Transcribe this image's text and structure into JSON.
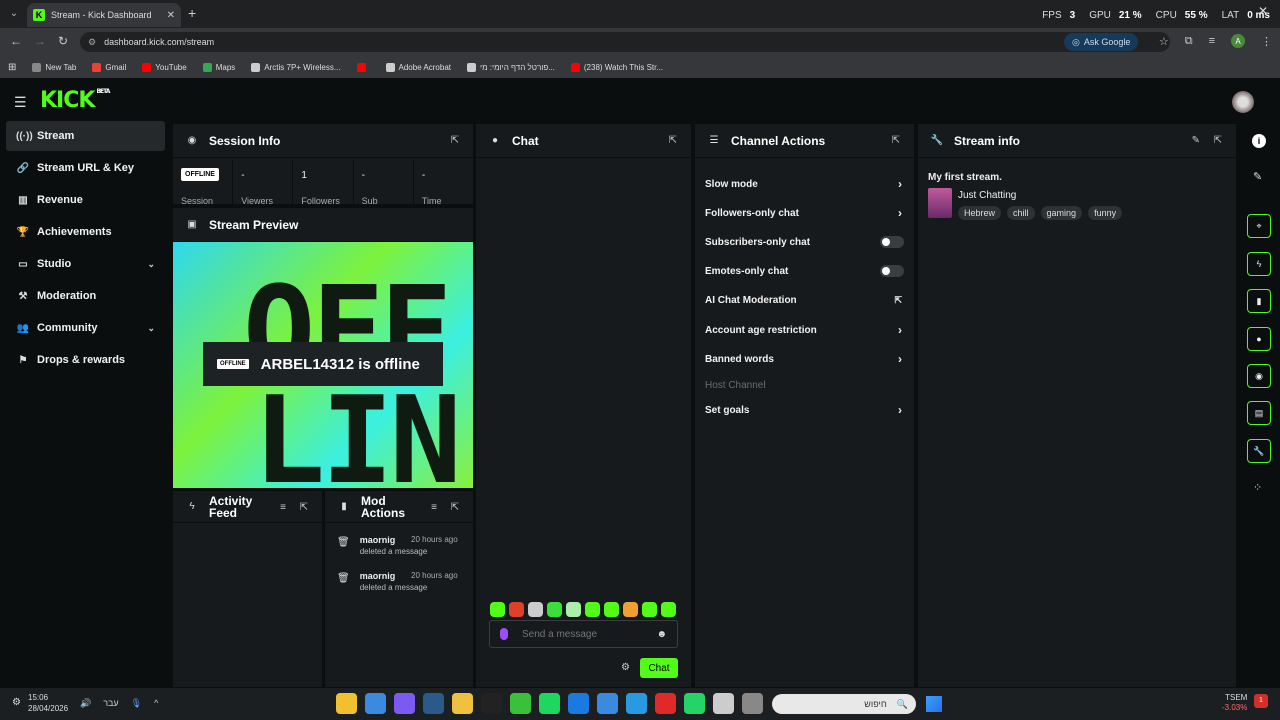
{
  "browser": {
    "tab_title": "Stream - Kick Dashboard",
    "tab_favicon": "K",
    "url": "dashboard.kick.com/stream",
    "ask_google": "Ask Google",
    "perf": [
      {
        "label": "FPS",
        "value": "3"
      },
      {
        "label": "GPU",
        "value": "21 %"
      },
      {
        "label": "CPU",
        "value": "55 %"
      },
      {
        "label": "LAT",
        "value": "0 ms"
      }
    ],
    "bookmarks": [
      {
        "label": "New Tab",
        "color": "#888888"
      },
      {
        "label": "Gmail",
        "color": "#ea4335"
      },
      {
        "label": "YouTube",
        "color": "#ff0000"
      },
      {
        "label": "Maps",
        "color": "#34a853"
      },
      {
        "label": "Arctis 7P+ Wireless...",
        "color": "#cccccc"
      },
      {
        "label": "",
        "color": "#ff0000"
      },
      {
        "label": "Adobe Acrobat",
        "color": "#cccccc"
      },
      {
        "label": "פורטל הדף היומי: מי...",
        "color": "#cccccc"
      },
      {
        "label": "(238) Watch This Str...",
        "color": "#ff0000"
      }
    ]
  },
  "kick": {
    "logo_text": "KICK",
    "logo_sup": "BETA",
    "accent": "#53fc18"
  },
  "sidebar": {
    "items": [
      {
        "label": "Stream",
        "icon": "broadcast-icon",
        "glyph": "((·))",
        "active": true
      },
      {
        "label": "Stream URL & Key",
        "icon": "link-icon",
        "glyph": "🔗"
      },
      {
        "label": "Revenue",
        "icon": "chart-icon",
        "glyph": "▥"
      },
      {
        "label": "Achievements",
        "icon": "trophy-icon",
        "glyph": "🏆"
      },
      {
        "label": "Studio",
        "icon": "tv-icon",
        "glyph": "▭",
        "expandable": true
      },
      {
        "label": "Moderation",
        "icon": "hammer-icon",
        "glyph": "⚒"
      },
      {
        "label": "Community",
        "icon": "people-icon",
        "glyph": "👥",
        "expandable": true
      },
      {
        "label": "Drops & rewards",
        "icon": "gift-icon",
        "glyph": "⚑"
      }
    ]
  },
  "session_info": {
    "title": "Session Info",
    "stats": [
      {
        "value": "OFFLINE",
        "label": "Session",
        "badge": true
      },
      {
        "value": "-",
        "label": "Viewers"
      },
      {
        "value": "1",
        "label": "Followers"
      },
      {
        "value": "-",
        "label": "Sub"
      },
      {
        "value": "-",
        "label": "Time"
      }
    ]
  },
  "stream_preview": {
    "title": "Stream Preview",
    "badge": "OFFLINE",
    "status_text": "ARBEL14312 is offline",
    "bg_text_top": "OFF",
    "bg_text_bottom": "LIN"
  },
  "activity_feed": {
    "title_line1": "Activity",
    "title_line2": "Feed"
  },
  "mod_actions": {
    "title_line1": "Mod",
    "title_line2": "Actions",
    "items": [
      {
        "user": "maornig",
        "time": "20 hours ago",
        "action": "deleted a message"
      },
      {
        "user": "maornig",
        "time": "20 hours ago",
        "action": "deleted a message"
      }
    ]
  },
  "chat": {
    "title": "Chat",
    "placeholder": "Send a message",
    "send_label": "Chat",
    "emote_colors": [
      "#53fc18",
      "#e0402a",
      "#cccccc",
      "#3ae03a",
      "#aaf0aa",
      "#53fc18",
      "#53fc18",
      "#f0a030",
      "#53fc18",
      "#53fc18"
    ]
  },
  "channel_actions": {
    "title": "Channel Actions",
    "rows": [
      {
        "label": "Slow mode",
        "control": "arrow"
      },
      {
        "label": "Followers-only chat",
        "control": "arrow"
      },
      {
        "label": "Subscribers-only chat",
        "control": "toggle"
      },
      {
        "label": "Emotes-only chat",
        "control": "toggle"
      },
      {
        "label": "AI Chat Moderation",
        "control": "external"
      },
      {
        "label": "Account age restriction",
        "control": "arrow"
      },
      {
        "label": "Banned words",
        "control": "arrow"
      },
      {
        "label": "Host Channel",
        "control": "disabled"
      },
      {
        "label": "Set goals",
        "control": "arrow"
      }
    ]
  },
  "stream_info": {
    "title": "Stream info",
    "stream_title": "My first stream.",
    "category": "Just Chatting",
    "tags": [
      "Hebrew",
      "chill",
      "gaming",
      "funny"
    ]
  },
  "taskbar": {
    "time": "15:06",
    "date": "28/04/2026",
    "lang": "עבר",
    "search_placeholder": "חיפוש",
    "stock_name": "TSEM",
    "stock_change": "-3.03%",
    "notif_count": "1",
    "app_colors": [
      "#f0c030",
      "#3a8ae0",
      "#7a5af0",
      "#2a5a8a",
      "#f0c040",
      "#222222",
      "#3ac03a",
      "#1ed760",
      "#1a7ae0",
      "#3a8ae0",
      "#2a9ae0",
      "#e02a2a",
      "#25d366",
      "#cccccc",
      "#888888"
    ]
  }
}
